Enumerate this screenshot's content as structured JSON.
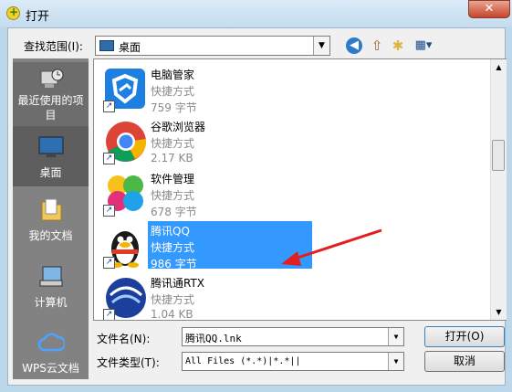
{
  "window": {
    "title": "打开",
    "close_glyph": "✕"
  },
  "lookin": {
    "label": "查找范围(I):",
    "value": "桌面"
  },
  "toolbar": {
    "back": "back-icon",
    "up": "up-folder-icon",
    "new_folder": "new-folder-icon",
    "views": "views-menu-icon"
  },
  "places": [
    {
      "label": "最近使用的项目"
    },
    {
      "label": "桌面"
    },
    {
      "label": "我的文档"
    },
    {
      "label": "计算机"
    },
    {
      "label": "WPS云文档"
    }
  ],
  "files": [
    {
      "name": "电脑管家",
      "kind": "快捷方式",
      "size": "759 字节"
    },
    {
      "name": "谷歌浏览器",
      "kind": "快捷方式",
      "size": "2.17 KB"
    },
    {
      "name": "软件管理",
      "kind": "快捷方式",
      "size": "678 字节"
    },
    {
      "name": "腾讯QQ",
      "kind": "快捷方式",
      "size": "986 字节",
      "selected": true
    },
    {
      "name": "腾讯通RTX",
      "kind": "快捷方式",
      "size": "1.04 KB"
    }
  ],
  "filename": {
    "label": "文件名(N):",
    "value": "腾讯QQ.lnk"
  },
  "filetype": {
    "label": "文件类型(T):",
    "value": "All Files (*.*)|*.*||"
  },
  "buttons": {
    "open": "打开(O)",
    "cancel": "取消"
  },
  "colors": {
    "selection": "#3399ff",
    "places_bg": "#828282",
    "annotation_arrow": "#e02020"
  }
}
